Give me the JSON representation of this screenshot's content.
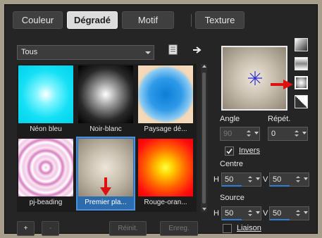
{
  "tabs": [
    {
      "label": "Couleur"
    },
    {
      "label": "Dégradé"
    },
    {
      "label": "Motif"
    },
    {
      "label": "Texture"
    }
  ],
  "category": {
    "selected": "Tous"
  },
  "gradients": [
    {
      "name": "Néon bleu"
    },
    {
      "name": "Noir-blanc"
    },
    {
      "name": "Paysage dé..."
    },
    {
      "name": "pj-beading"
    },
    {
      "name": "Premier pla..."
    },
    {
      "name": "Rouge-oran..."
    }
  ],
  "bottom_buttons": {
    "add": "+",
    "remove": "-",
    "reset": "Réinit.",
    "save": "Enreg."
  },
  "settings": {
    "angle_label": "Angle",
    "angle_value": "90",
    "repeat_label": "Répét.",
    "repeat_value": "0",
    "invert_label": "Invers",
    "invert_checked": true,
    "center_label": "Centre",
    "center_h_label": "H",
    "center_h": "50",
    "center_v_label": "V",
    "center_v": "50",
    "source_label": "Source",
    "source_h_label": "H",
    "source_h": "50",
    "source_v_label": "V",
    "source_v": "50",
    "link_label": "Liaison",
    "link_checked": false
  },
  "colors": {
    "accent": "#2f7fd6",
    "selection": "#2c6cad",
    "annotation_arrow": "#e01010"
  }
}
